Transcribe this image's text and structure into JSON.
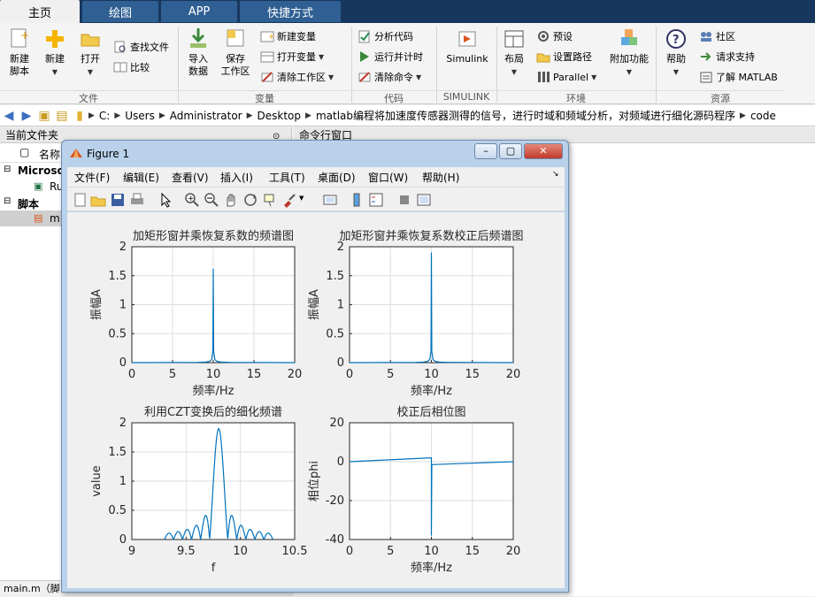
{
  "tabs": [
    "主页",
    "绘图",
    "APP",
    "快捷方式"
  ],
  "ribbon": {
    "new_script": "新建\n脚本",
    "new": "新建",
    "open": "打开",
    "find_files": "查找文件",
    "compare": "比较",
    "import_data": "导入\n数据",
    "save_workspace": "保存\n工作区",
    "new_variable": "新建变量",
    "open_variable": "打开变量",
    "clear_workspace": "清除工作区",
    "analyze_code": "分析代码",
    "run_and_time": "运行并计时",
    "clear_commands": "清除命令",
    "simulink": "Simulink",
    "layout": "布局",
    "preferences": "预设",
    "set_path": "设置路径",
    "parallel": "Parallel",
    "addons": "附加功能",
    "help": "帮助",
    "community": "社区",
    "request_support": "请求支持",
    "learn_matlab": "了解 MATLAB",
    "groups": [
      "文件",
      "变量",
      "代码",
      "SIMULINK",
      "环境",
      "资源"
    ]
  },
  "address": {
    "crumbs": [
      "C:",
      "Users",
      "Administrator",
      "Desktop",
      "matlab编程将加速度传感器测得的信号，进行时域和频域分析，对频域进行细化源码程序",
      "code"
    ]
  },
  "left_panel": {
    "title": "当前文件夹",
    "col_name": "名称",
    "group1": "Microso",
    "file1": "Ru",
    "group2": "脚本",
    "file2": "m"
  },
  "right_panel": {
    "title": "命令行窗口"
  },
  "status": {
    "text": "main.m（脚"
  },
  "figure": {
    "title": "Figure 1",
    "menu": [
      "文件(F)",
      "编辑(E)",
      "查看(V)",
      "插入(I)",
      "工具(T)",
      "桌面(D)",
      "窗口(W)",
      "帮助(H)"
    ]
  },
  "chart_data": [
    {
      "type": "line",
      "title": "加矩形窗并乘恢复系数的频谱图",
      "xlabel": "频率/Hz",
      "ylabel": "振幅A",
      "xlim": [
        0,
        20
      ],
      "ylim": [
        0,
        2
      ],
      "xticks": [
        0,
        5,
        10,
        15,
        20
      ],
      "yticks": [
        0,
        0.5,
        1,
        1.5,
        2
      ],
      "grid": true,
      "x": [
        0,
        8,
        9,
        9.5,
        9.8,
        9.95,
        10,
        10.05,
        10.2,
        10.5,
        11,
        12,
        20
      ],
      "y": [
        0,
        0.005,
        0.01,
        0.02,
        0.05,
        0.2,
        1.62,
        0.2,
        0.05,
        0.02,
        0.01,
        0.005,
        0
      ]
    },
    {
      "type": "line",
      "title": "加矩形窗并乘恢复系数校正后频谱图",
      "xlabel": "频率/Hz",
      "ylabel": "振幅A",
      "xlim": [
        0,
        20
      ],
      "ylim": [
        0,
        2
      ],
      "xticks": [
        0,
        5,
        10,
        15,
        20
      ],
      "yticks": [
        0,
        0.5,
        1,
        1.5,
        2
      ],
      "grid": true,
      "x": [
        0,
        8,
        9,
        9.5,
        9.8,
        9.95,
        10,
        10.05,
        10.2,
        10.5,
        11,
        12,
        20
      ],
      "y": [
        0,
        0.005,
        0.01,
        0.02,
        0.05,
        0.2,
        1.9,
        0.2,
        0.05,
        0.02,
        0.01,
        0.005,
        0
      ]
    },
    {
      "type": "line",
      "title": "利用CZT变换后的细化频谱",
      "xlabel": "f",
      "ylabel": "value",
      "xlim": [
        9,
        10.5
      ],
      "ylim": [
        0,
        2
      ],
      "xticks": [
        9,
        9.5,
        10,
        10.5
      ],
      "yticks": [
        0,
        0.5,
        1,
        1.5,
        2
      ],
      "grid": true,
      "center": 9.8,
      "peak": 1.9,
      "x_range": [
        9.3,
        10.3
      ]
    },
    {
      "type": "line",
      "title": "校正后相位图",
      "xlabel": "频率/Hz",
      "ylabel": "相位phi",
      "xlim": [
        0,
        20
      ],
      "ylim": [
        -40,
        20
      ],
      "xticks": [
        0,
        5,
        10,
        15,
        20
      ],
      "yticks": [
        -40,
        -20,
        0,
        20
      ],
      "grid": true,
      "x": [
        0,
        10,
        10,
        10.05,
        20
      ],
      "y": [
        0,
        2,
        -38,
        -1.5,
        0
      ]
    }
  ]
}
